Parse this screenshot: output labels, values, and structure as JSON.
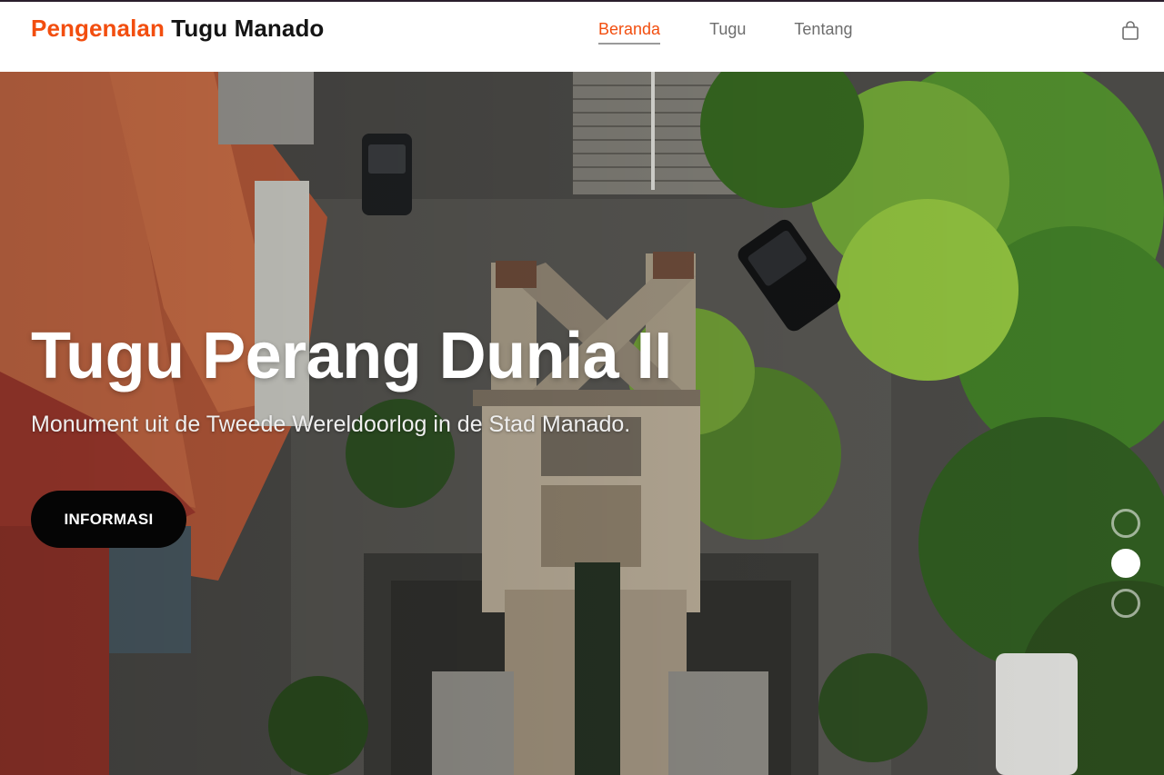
{
  "header": {
    "brand_accent": "Pengenalan",
    "brand_rest": "Tugu Manado",
    "nav": [
      {
        "label": "Beranda",
        "active": true
      },
      {
        "label": "Tugu",
        "active": false
      },
      {
        "label": "Tentang",
        "active": false
      }
    ],
    "cart_icon": "shopping-bag-icon"
  },
  "hero": {
    "title": "Tugu Perang Dunia II",
    "subtitle": "Monument uit de Tweede Wereldoorlog in de Stad Manado.",
    "cta_label": "INFORMASI",
    "slides_total": 3,
    "active_slide": 2
  },
  "colors": {
    "accent": "#f24e0f",
    "dark": "#141414",
    "cta_bg": "#050505"
  }
}
